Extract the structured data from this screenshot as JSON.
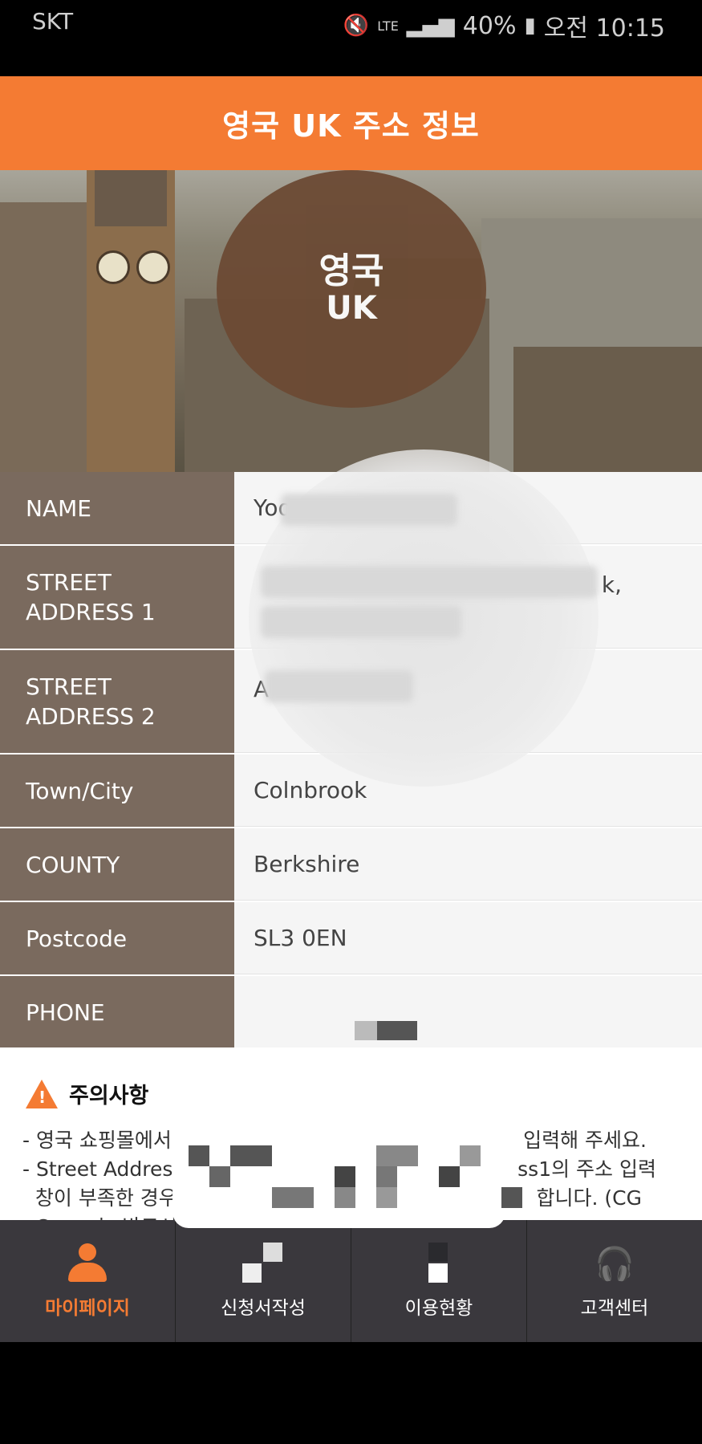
{
  "status": {
    "carrier": "SKT",
    "battery": "40%",
    "time": "오전 10:15",
    "network": "LTE"
  },
  "header": {
    "title": "영국 UK 주소 정보"
  },
  "badge": {
    "line1": "영국",
    "line2": "UK"
  },
  "rows": [
    {
      "label": "NAME",
      "value": "Yoo"
    },
    {
      "label": "STREET\nADDRESS 1",
      "value": "k,"
    },
    {
      "label": "STREET\nADDRESS 2",
      "value": "A"
    },
    {
      "label": "Town/City",
      "value": "Colnbrook"
    },
    {
      "label": "COUNTY",
      "value": "Berkshire"
    },
    {
      "label": "Postcode",
      "value": "SL3 0EN"
    },
    {
      "label": "PHONE",
      "value": ""
    }
  ],
  "notice": {
    "title": "주의사항",
    "line1": "- 영국 쇼핑몰에서",
    "line1b": "입력해 주세요.",
    "line2": "- Street Addres",
    "line2b": "ss1의 주소 입력",
    "line3": "  창이 부족한 경우",
    "line3b": "합니다. (CG",
    "line4": "  Consu는 반드시"
  },
  "nav": [
    {
      "label": "마이페이지",
      "icon": "person-icon"
    },
    {
      "label": "신청서작성",
      "icon": "form-icon"
    },
    {
      "label": "이용현황",
      "icon": "status-icon"
    },
    {
      "label": "고객센터",
      "icon": "headset-icon"
    }
  ],
  "colors": {
    "accent": "#f47b33",
    "label_bg": "#7a6a5e",
    "nav_bg": "#3a383d"
  }
}
